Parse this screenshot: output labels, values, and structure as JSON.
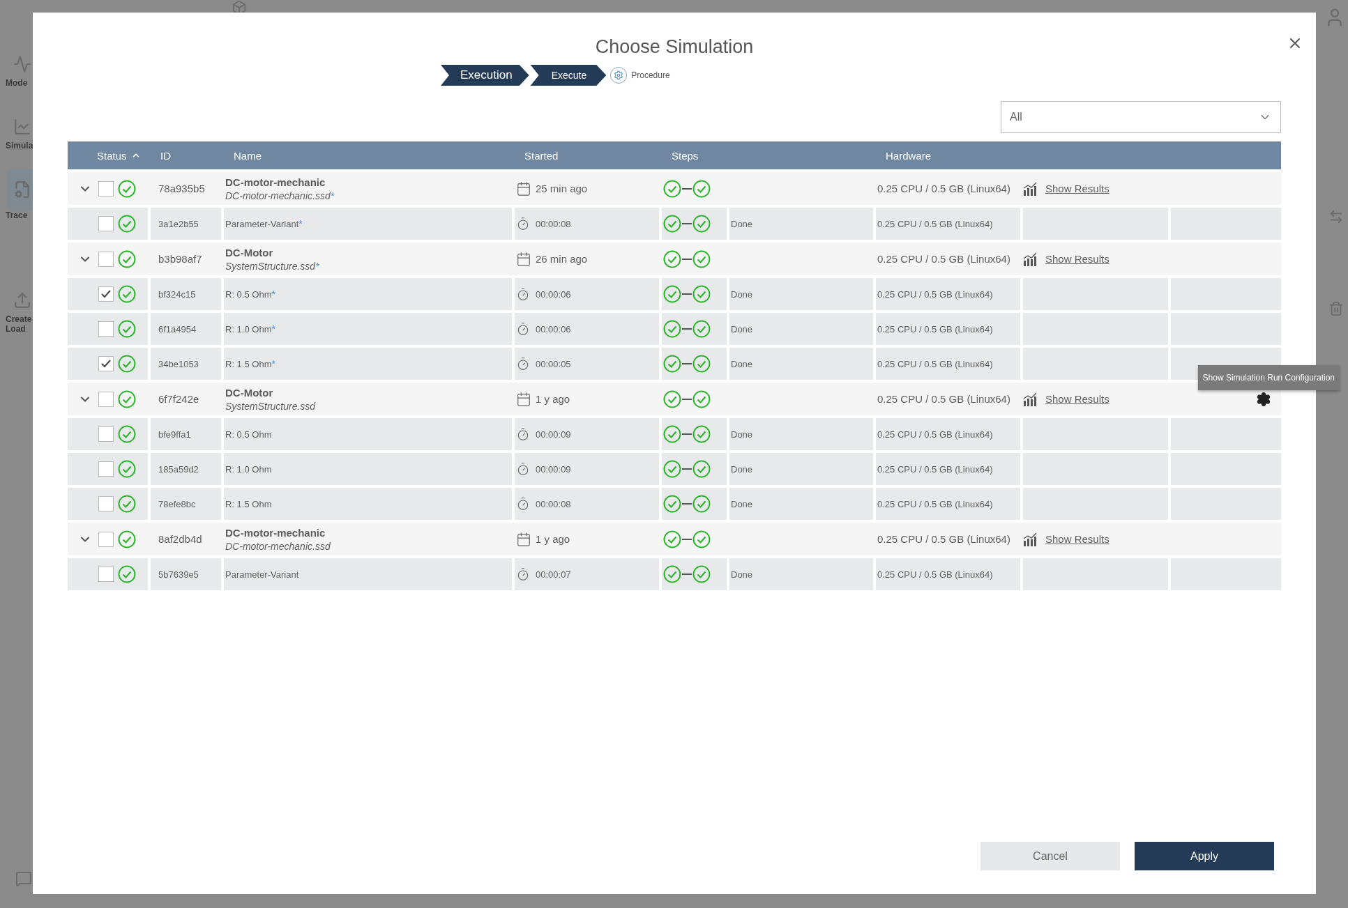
{
  "backdrop": {
    "nav": [
      {
        "label": "Mode",
        "kind": "model"
      },
      {
        "label": "Simula",
        "kind": "sim",
        "selected": false
      },
      {
        "label": "Trace",
        "kind": "trace",
        "selected": true
      },
      {
        "label": "Create",
        "kind": "upload"
      },
      {
        "label": "Load",
        "kind": "none"
      }
    ]
  },
  "dialog": {
    "title": "Choose Simulation",
    "breadcrumb": [
      {
        "label": "Execution",
        "kind": "primary"
      },
      {
        "label": "Execute",
        "kind": "secondary"
      },
      {
        "label": "Procedure",
        "kind": "pending"
      }
    ],
    "filter": {
      "value": "All"
    },
    "columns": [
      {
        "label": "Status",
        "sorted": true
      },
      {
        "label": "ID",
        "sorted": false
      },
      {
        "label": "Name",
        "sorted": false
      },
      {
        "label": "Started",
        "sorted": false
      },
      {
        "label": "Steps",
        "sorted": false
      },
      {
        "label": "Hardware",
        "sorted": false
      }
    ],
    "rows": [
      {
        "expanded": true,
        "checked": false,
        "succeeded": true,
        "id": "78a935b5",
        "name": "DC-motor-mechanic",
        "file": "DC-motor-mechanic.ssd",
        "asterisk": "*",
        "started": "25 min ago",
        "steps": [
          {
            "succeeded": true
          },
          {
            "succeeded": true
          }
        ],
        "hardware": "0.25 CPU / 0.5 GB (Linux64)",
        "link": "Show Results",
        "children": [
          {
            "checked": false,
            "succeeded": true,
            "id": "3a1e2b55",
            "name": "Parameter-Variant",
            "asterisk": "*",
            "duration": "00:00:08",
            "steps": [
              {
                "succeeded": true
              },
              {
                "succeeded": true
              }
            ],
            "state": "Done",
            "hardware": "0.25 CPU / 0.5 GB (Linux64)"
          }
        ]
      },
      {
        "expanded": true,
        "checked": false,
        "succeeded": true,
        "id": "b3b98af7",
        "name": "DC-Motor",
        "file": "SystemStructure.ssd",
        "asterisk": "*",
        "started": "26 min ago",
        "steps": [
          {
            "succeeded": true
          },
          {
            "succeeded": true
          }
        ],
        "hardware": "0.25 CPU / 0.5 GB (Linux64)",
        "link": "Show Results",
        "children": [
          {
            "checked": true,
            "succeeded": true,
            "id": "bf324c15",
            "name": "R: 0.5 Ohm",
            "asterisk": "*",
            "duration": "00:00:06",
            "steps": [
              {
                "succeeded": true
              },
              {
                "succeeded": true
              }
            ],
            "state": "Done",
            "hardware": "0.25 CPU / 0.5 GB (Linux64)"
          },
          {
            "checked": false,
            "succeeded": true,
            "id": "6f1a4954",
            "name": "R: 1.0 Ohm",
            "asterisk": "*",
            "duration": "00:00:06",
            "steps": [
              {
                "succeeded": true
              },
              {
                "succeeded": true
              }
            ],
            "state": "Done",
            "hardware": "0.25 CPU / 0.5 GB (Linux64)"
          },
          {
            "checked": true,
            "succeeded": true,
            "id": "34be1053",
            "name": "R: 1.5 Ohm",
            "asterisk": "*",
            "duration": "00:00:05",
            "steps": [
              {
                "succeeded": true
              },
              {
                "succeeded": true
              }
            ],
            "state": "Done",
            "hardware": "0.25 CPU / 0.5 GB (Linux64)"
          }
        ]
      },
      {
        "expanded": true,
        "checked": false,
        "succeeded": true,
        "id": "6f7f242e",
        "name": "DC-Motor",
        "file": "SystemStructure.ssd",
        "started": "1 y ago",
        "steps": [
          {
            "succeeded": true
          },
          {
            "succeeded": true
          }
        ],
        "hardware": "0.25 CPU / 0.5 GB (Linux64)",
        "link": "Show Results",
        "config": true,
        "tooltip": "Show Simulation Run Configuration",
        "children": [
          {
            "checked": false,
            "succeeded": true,
            "id": "bfe9ffa1",
            "name": "R: 0.5 Ohm",
            "duration": "00:00:09",
            "steps": [
              {
                "succeeded": true
              },
              {
                "succeeded": true
              }
            ],
            "state": "Done",
            "hardware": "0.25 CPU / 0.5 GB (Linux64)"
          },
          {
            "checked": false,
            "succeeded": true,
            "id": "185a59d2",
            "name": "R: 1.0 Ohm",
            "duration": "00:00:09",
            "steps": [
              {
                "succeeded": true
              },
              {
                "succeeded": true
              }
            ],
            "state": "Done",
            "hardware": "0.25 CPU / 0.5 GB (Linux64)"
          },
          {
            "checked": false,
            "succeeded": true,
            "id": "78efe8bc",
            "name": "R: 1.5 Ohm",
            "duration": "00:00:08",
            "steps": [
              {
                "succeeded": true
              },
              {
                "succeeded": true
              }
            ],
            "state": "Done",
            "hardware": "0.25 CPU / 0.5 GB (Linux64)"
          }
        ]
      },
      {
        "expanded": true,
        "checked": false,
        "succeeded": true,
        "id": "8af2db4d",
        "name": "DC-motor-mechanic",
        "file": "DC-motor-mechanic.ssd",
        "started": "1 y ago",
        "steps": [
          {
            "succeeded": true
          },
          {
            "succeeded": true
          }
        ],
        "hardware": "0.25 CPU / 0.5 GB (Linux64)",
        "link": "Show Results",
        "children": [
          {
            "checked": false,
            "succeeded": true,
            "id": "5b7639e5",
            "name": "Parameter-Variant",
            "duration": "00:00:07",
            "steps": [
              {
                "succeeded": true
              },
              {
                "succeeded": true
              }
            ],
            "state": "Done",
            "hardware": "0.25 CPU / 0.5 GB (Linux64)"
          }
        ]
      }
    ],
    "buttons": [
      {
        "label": "Cancel",
        "kind": "secondary"
      },
      {
        "label": "Apply",
        "kind": "primary"
      }
    ]
  }
}
